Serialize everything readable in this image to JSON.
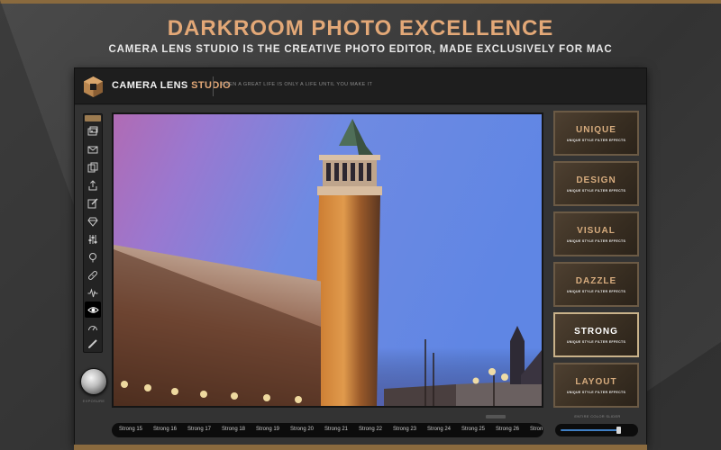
{
  "hero": {
    "title": "DARKROOM PHOTO EXCELLENCE",
    "subtitle": "CAMERA LENS STUDIO IS THE CREATIVE PHOTO EDITOR, MADE EXCLUSIVELY FOR MAC"
  },
  "app": {
    "name_part1": "CAMERA LENS ",
    "name_part2": "STUDIO",
    "tagline": "EVEN A GREAT LIFE IS ONLY A LIFE UNTIL YOU MAKE IT",
    "accent_color": "#e3a877"
  },
  "toolbar": {
    "tools": [
      {
        "icon": "photos-icon"
      },
      {
        "icon": "mail-icon"
      },
      {
        "icon": "copy-icon"
      },
      {
        "icon": "share-icon"
      },
      {
        "icon": "edit-icon"
      },
      {
        "icon": "diamond-icon"
      },
      {
        "icon": "sliders-icon"
      },
      {
        "icon": "pin-icon"
      },
      {
        "icon": "bandage-icon"
      },
      {
        "icon": "waveform-icon"
      },
      {
        "icon": "eye-icon",
        "active": true
      },
      {
        "icon": "gauge-icon"
      },
      {
        "icon": "pencil-icon"
      }
    ],
    "knob_label": "EXPOSURE"
  },
  "filters": [
    {
      "name": "UNIQUE",
      "sub": "UNIQUE STYLE FILTER EFFECTS"
    },
    {
      "name": "DESIGN",
      "sub": "UNIQUE STYLE FILTER EFFECTS"
    },
    {
      "name": "VISUAL",
      "sub": "UNIQUE STYLE FILTER EFFECTS"
    },
    {
      "name": "DAZZLE",
      "sub": "UNIQUE STYLE FILTER EFFECTS"
    },
    {
      "name": "STRONG",
      "sub": "UNIQUE STYLE FILTER EFFECTS",
      "active": true
    },
    {
      "name": "LAYOUT",
      "sub": "UNIQUE STYLE FILTER EFFECTS"
    }
  ],
  "presets": [
    "Strong 15",
    "Strong 16",
    "Strong 17",
    "Strong 18",
    "Strong 19",
    "Strong 20",
    "Strong 21",
    "Strong 22",
    "Strong 23",
    "Strong 24",
    "Strong 25",
    "Strong 26",
    "Stron"
  ],
  "slider": {
    "label": "ENTIRE COLOR SLIDER",
    "value": 0.8,
    "fill_color": "#3f7fc4"
  }
}
